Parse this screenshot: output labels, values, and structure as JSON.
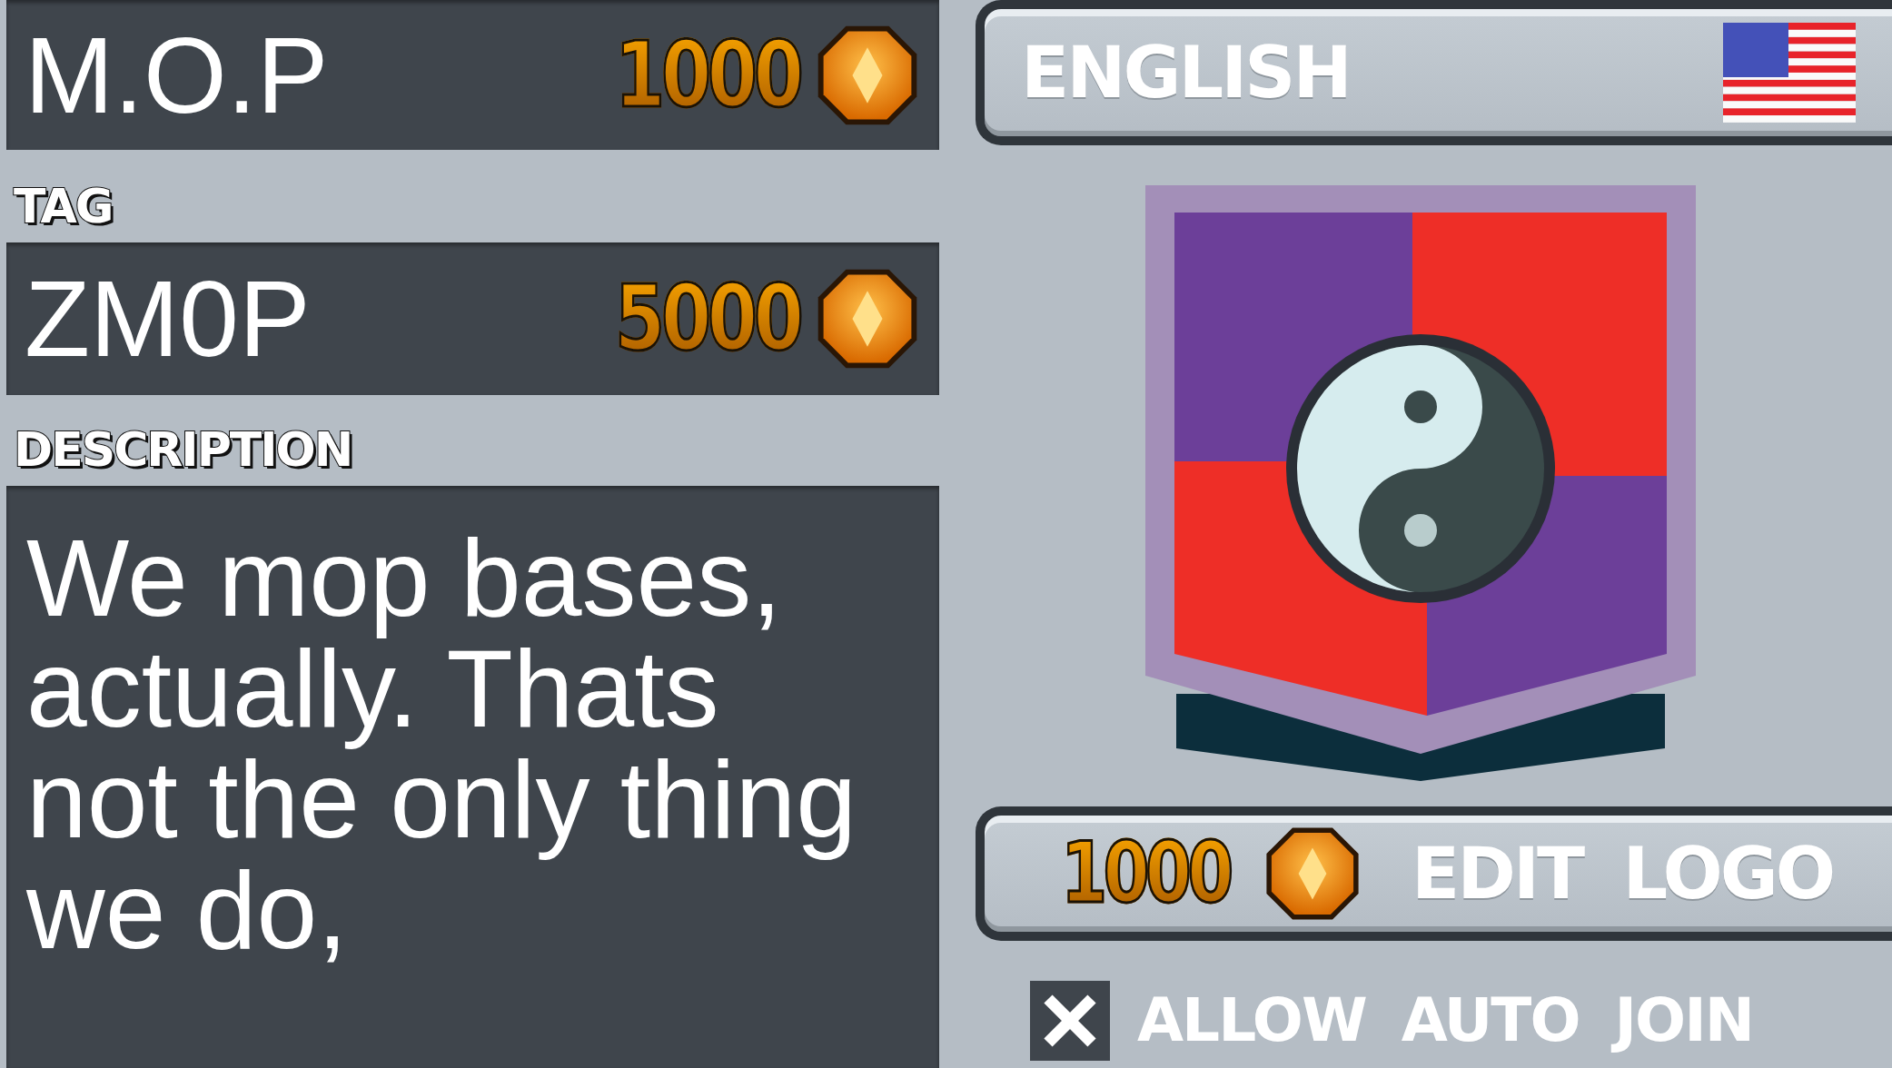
{
  "name_field": {
    "value": "M.O.P",
    "cost": "1000"
  },
  "tag_label": "TAG",
  "tag_field": {
    "value": "ZM0P",
    "cost": "5000"
  },
  "description_label": "DESCRIPTION",
  "description_field": {
    "value": "We mop bases, actually. Thats not the only thing we do,"
  },
  "language_button": {
    "label": "ENGLISH"
  },
  "edit_logo_button": {
    "cost": "1000",
    "label": "EDIT LOGO"
  },
  "auto_join": {
    "label": "ALLOW AUTO JOIN",
    "checked": false
  }
}
